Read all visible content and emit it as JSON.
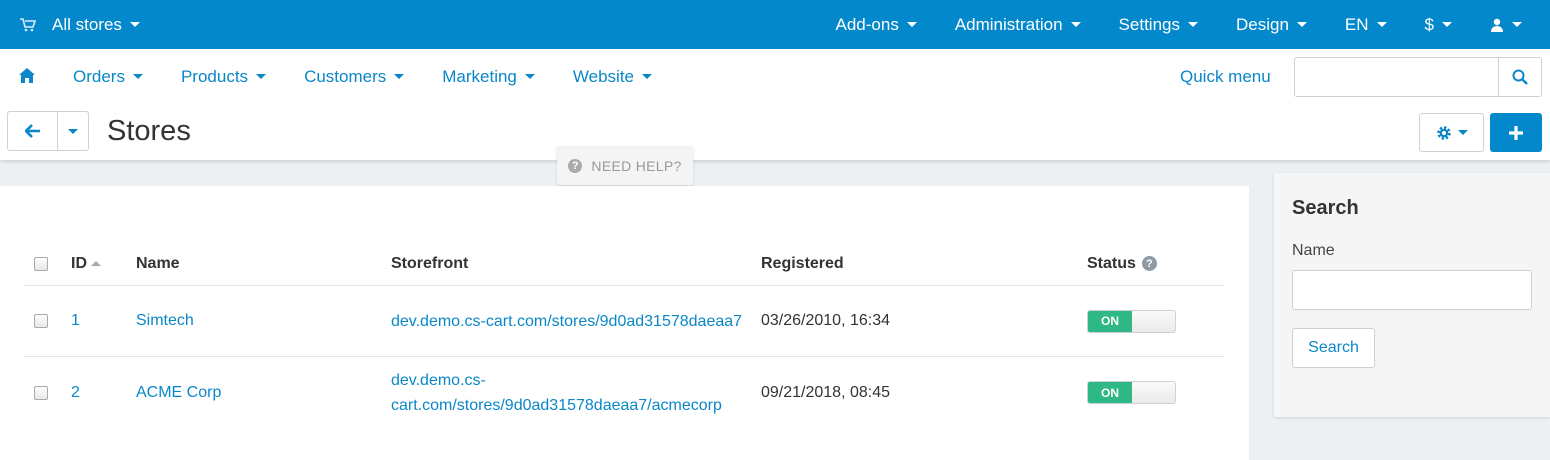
{
  "topbar": {
    "store_selector": "All stores",
    "menu": [
      {
        "label": "Add-ons"
      },
      {
        "label": "Administration"
      },
      {
        "label": "Settings"
      },
      {
        "label": "Design"
      },
      {
        "label": "EN"
      },
      {
        "label": "$"
      }
    ],
    "background_color": "#0388cc"
  },
  "subnav": {
    "menu": [
      {
        "label": "Orders"
      },
      {
        "label": "Products"
      },
      {
        "label": "Customers"
      },
      {
        "label": "Marketing"
      },
      {
        "label": "Website"
      }
    ],
    "quick_menu": "Quick menu",
    "search_value": ""
  },
  "page": {
    "title": "Stores",
    "need_help": "NEED HELP?"
  },
  "table": {
    "headers": {
      "id": "ID",
      "name": "Name",
      "storefront": "Storefront",
      "registered": "Registered",
      "status": "Status"
    },
    "rows": [
      {
        "id": "1",
        "name": "Simtech",
        "storefront": "dev.demo.cs-cart.com/stores/9d0ad31578daeaa7",
        "registered": "03/26/2010, 16:34",
        "status": "ON"
      },
      {
        "id": "2",
        "name": "ACME Corp",
        "storefront": "dev.demo.cs-cart.com/stores/9d0ad31578daeaa7/acmecorp",
        "registered": "09/21/2018, 08:45",
        "status": "ON"
      }
    ]
  },
  "sidebar": {
    "title": "Search",
    "name_label": "Name",
    "name_value": "",
    "search_button": "Search"
  },
  "colors": {
    "accent": "#0388cc",
    "link": "#0b87c8",
    "status_on": "#2eb886"
  }
}
